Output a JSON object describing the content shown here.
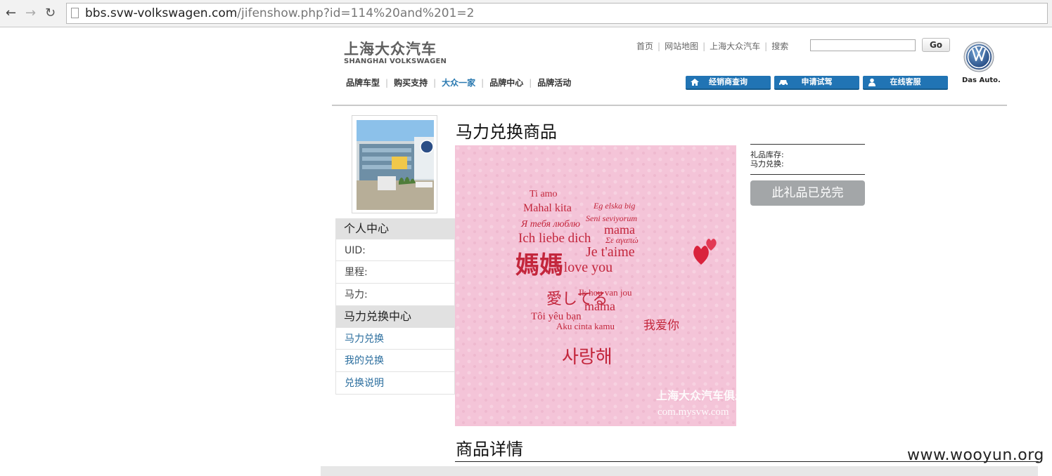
{
  "browser": {
    "url_host": "bbs.svw-volkswagen.com",
    "url_path": "/jifenshow.php?id=114%20and%201=2"
  },
  "header": {
    "logo_cn": "上海大众汽车",
    "logo_en": "SHANGHAI VOLKSWAGEN",
    "top_links": [
      "首页",
      "网站地图",
      "上海大众汽车",
      "搜索"
    ],
    "search_go": "Go",
    "brand_tagline": "Das Auto.",
    "main_nav": [
      "品牌车型",
      "购买支持",
      "大众一家",
      "品牌中心",
      "品牌活动"
    ],
    "action_buttons": [
      "经销商查询",
      "申请试驾",
      "在线客服"
    ]
  },
  "sidebar": {
    "personal_title": "个人中心",
    "uid_label": "UID:",
    "mileage_label": "里程:",
    "horsepower_label": "马力:",
    "exchange_title": "马力兑换中心",
    "links": [
      "马力兑换",
      "我的兑换",
      "兑换说明"
    ]
  },
  "product": {
    "title": "马力兑换商品",
    "stock_label": "礼品库存:",
    "exchange_label": "马力兑换:",
    "sold_out": "此礼品已兑完",
    "detail_title": "商品详情",
    "image_words": [
      "Ti amo",
      "Mahal kita",
      "Eg elska big",
      "Seni seviyorum",
      "Я тебя люблю",
      "mama",
      "Ich liebe dich",
      "Σε αγαπώ",
      "媽媽",
      "I love you",
      "Je t'aime",
      "愛してる",
      "사랑해",
      "mama",
      "Ik hou van jou",
      "Tôi yêu bạn",
      "Aku cinta kamu",
      "我爱你",
      "上海大众汽车俱乐部",
      "com.mysvw.com"
    ]
  },
  "watermark": "www.wooyun.org"
}
